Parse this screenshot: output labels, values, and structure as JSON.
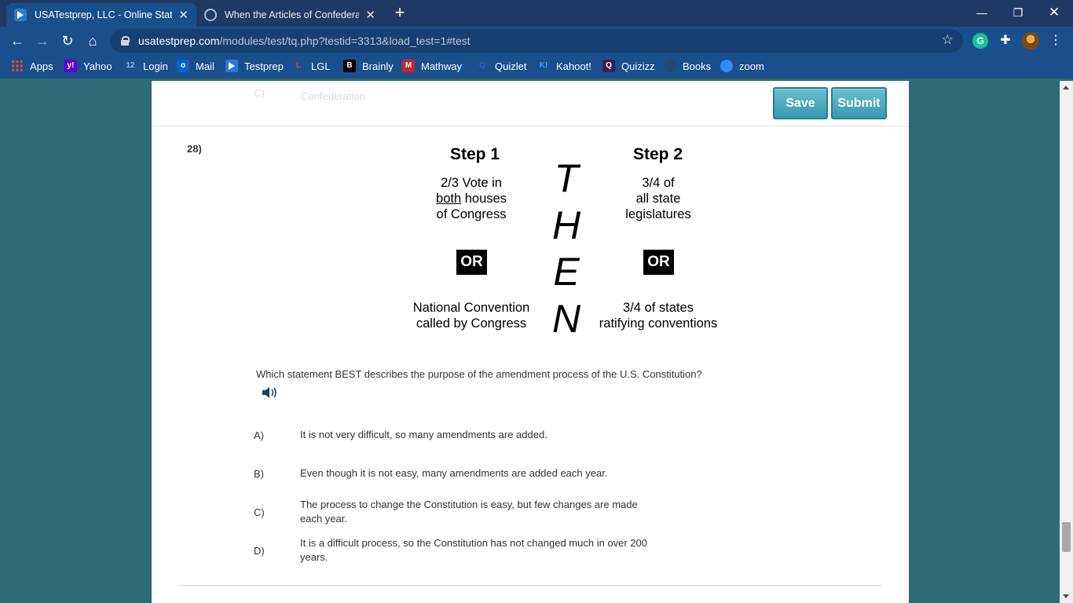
{
  "browser": {
    "tabs": [
      {
        "title": "USATestprep, LLC - Online State-S",
        "active": true
      },
      {
        "title": "When the Articles of Confederati",
        "active": false
      }
    ],
    "url_host": "usatestprep.com",
    "url_path": "/modules/test/tq.php?testid=3313&load_test=1#test",
    "bookmarks": [
      {
        "label": "Apps",
        "icon": "apps-grid-icon"
      },
      {
        "label": "Yahoo",
        "icon": "yahoo-icon",
        "glyph": "y!"
      },
      {
        "label": "Login",
        "icon": "login-icon",
        "glyph": "12"
      },
      {
        "label": "Mail",
        "icon": "outlook-icon",
        "glyph": "o"
      },
      {
        "label": "Testprep",
        "icon": "testprep-icon"
      },
      {
        "label": "LGL",
        "icon": "lgl-icon",
        "glyph": "L"
      },
      {
        "label": "Brainly",
        "icon": "brainly-icon",
        "glyph": "B"
      },
      {
        "label": "Mathway",
        "icon": "mathway-icon",
        "glyph": "M"
      },
      {
        "label": "Quizlet",
        "icon": "quizlet-icon",
        "glyph": "Q"
      },
      {
        "label": "Kahoot!",
        "icon": "kahoot-icon",
        "glyph": "K!"
      },
      {
        "label": "Quizizz",
        "icon": "quizizz-icon",
        "glyph": "Q"
      },
      {
        "label": "Books",
        "icon": "books-icon"
      },
      {
        "label": "zoom",
        "icon": "zoom-icon"
      }
    ],
    "colors": {
      "chrome": "#1a4f8c",
      "tabstrip": "#1e3a64",
      "page_bg": "#2b6b73"
    }
  },
  "page": {
    "save_label": "Save",
    "submit_label": "Submit",
    "prev_ghost_a": "C)",
    "prev_ghost_b": "Confederation",
    "question_number": "28)",
    "diagram": {
      "step1_title": "Step 1",
      "step2_title": "Step 2",
      "step1_a_line1": "2/3 Vote in",
      "step1_a_line2_u": "both",
      "step1_a_line2_rest": " houses",
      "step1_a_line3": "of Congress",
      "step2_a_line1": "3/4 of",
      "step2_a_line2": "all state",
      "step2_a_line3": "legislatures",
      "or_label": "OR",
      "step1_b_line1": "National Convention",
      "step1_b_line2": "called by Congress",
      "step2_b_line1": "3/4 of states",
      "step2_b_line2": "ratifying conventions",
      "then_letters": [
        "T",
        "H",
        "E",
        "N"
      ]
    },
    "question_text": "Which statement BEST describes the purpose of the amendment process of the U.S. Constitution?",
    "answers": [
      {
        "label": "A)",
        "text": "It is not very difficult, so many amendments are added."
      },
      {
        "label": "B)",
        "text": "Even though it is not easy, many amendments are added each year."
      },
      {
        "label": "C)",
        "text": "The process to change the Constitution is easy, but few changes are made each year."
      },
      {
        "label": "D)",
        "text": "It is a difficult process, so the Constitution has not changed much in over 200 years."
      }
    ],
    "button_color": "#3899ad"
  }
}
